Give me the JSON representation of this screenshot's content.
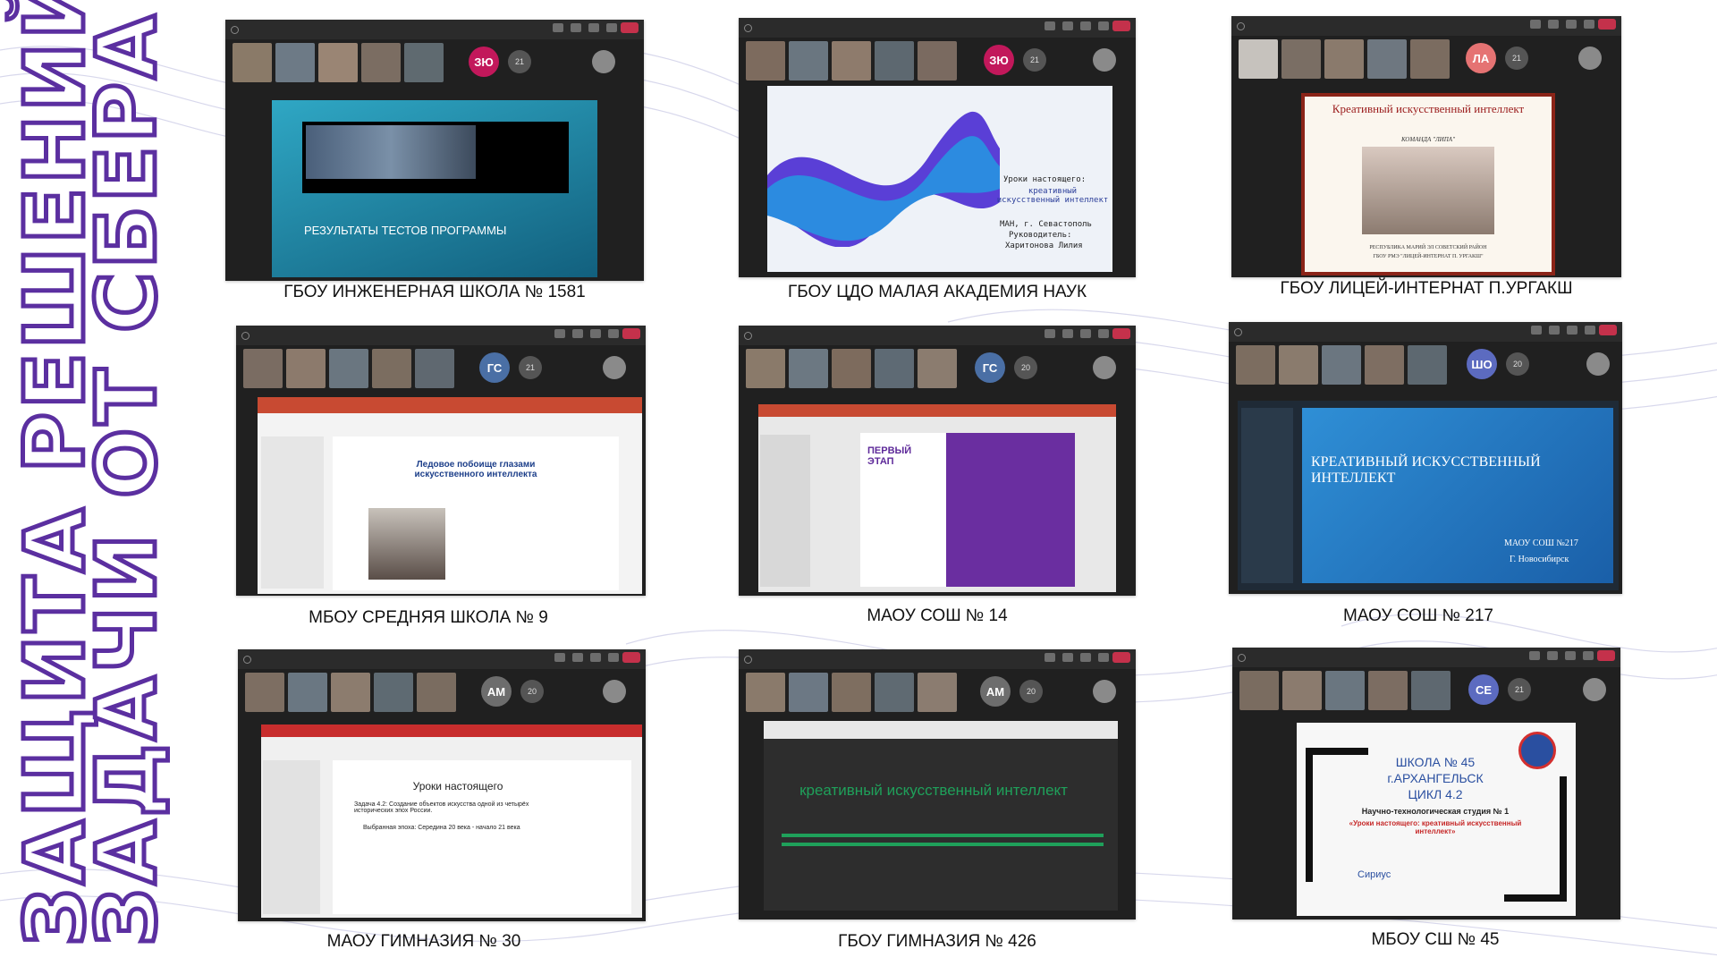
{
  "title": {
    "line1": "ЗАЩИТА РЕШЕНИЙ",
    "line2": "ЗАДАЧИ ОТ СБЕРА"
  },
  "colors": {
    "title_stroke": "#5b2fa0",
    "background_lines": "#d8d8ec"
  },
  "tiles": [
    {
      "caption": "ГБОУ ИНЖЕНЕРНАЯ ШКОЛА № 1581",
      "avatar": {
        "initials": "ЗЮ",
        "color": "#c2185b"
      },
      "slide": {
        "text": "РЕЗУЛЬТАТЫ ТЕСТОВ ПРОГРАММЫ"
      }
    },
    {
      "caption": "ГБОУ ЦДО МАЛАЯ АКАДЕМИЯ НАУК",
      "avatar": {
        "initials": "ЗЮ",
        "color": "#c2185b"
      },
      "slide": {
        "text1": "Уроки настоящего:",
        "text2": "креативный искусственный интеллект",
        "text3": "МАН, г. Севастополь",
        "text4": "Руководитель:",
        "text5": "Харитонова Лилия"
      }
    },
    {
      "caption": "ГБОУ ЛИЦЕЙ-ИНТЕРНАТ П.УРГАКШ",
      "avatar": {
        "initials": "ЛА",
        "color": "#e57373"
      },
      "slide": {
        "title": "Креативный искусственный интеллект",
        "subtitle": "КОМАНДА \"ЛИПА\"",
        "footer1": "РЕСПУБЛИКА МАРИЙ ЭЛ СОВЕТСКИЙ РАЙОН",
        "footer2": "ГБОУ РМЭ \"ЛИЦЕЙ-ИНТЕРНАТ П. УРГАКШ\""
      }
    },
    {
      "caption": "МБОУ СРЕДНЯЯ ШКОЛА № 9",
      "avatar": {
        "initials": "ГС",
        "color": "#4a6fa5"
      },
      "slide": {
        "title": "Ледовое побоище глазами искусственного интеллекта"
      }
    },
    {
      "caption": "МАОУ СОШ № 14",
      "avatar": {
        "initials": "ГС",
        "color": "#4a6fa5"
      },
      "slide": {
        "title": "ПЕРВЫЙ ЭТАП"
      }
    },
    {
      "caption": "МАОУ СОШ № 217",
      "avatar": {
        "initials": "ШО",
        "color": "#5c6bc0"
      },
      "slide": {
        "title": "КРЕАТИВНЫЙ ИСКУССТВЕННЫЙ ИНТЕЛЛЕКТ",
        "sub1": "МАОУ СОШ №217",
        "sub2": "Г. Новосибирск"
      }
    },
    {
      "caption": "МАОУ ГИМНАЗИЯ № 30",
      "avatar": {
        "initials": "АМ",
        "color": "#6d6d6d"
      },
      "slide": {
        "title": "Уроки настоящего",
        "bullet": "Задача 4.2: Создание объектов искусства одной из четырёх исторических эпох России.",
        "line": "Выбранная эпоха: Середина 20 века - начало 21 века"
      }
    },
    {
      "caption": "ГБОУ ГИМНАЗИЯ № 426",
      "avatar": {
        "initials": "АМ",
        "color": "#6d6d6d"
      },
      "slide": {
        "title": "креативный искусственный интеллект"
      }
    },
    {
      "caption": "МБОУ СШ № 45",
      "avatar": {
        "initials": "СЕ",
        "color": "#5c6bc0"
      },
      "slide": {
        "line1": "ШКОЛА № 45",
        "line2": "г.АРХАНГЕЛЬСК",
        "line3": "ЦИКЛ 4.2",
        "line4": "Научно-технологическая студия № 1",
        "line5": "«Уроки настоящего: креативный искусственный интеллект»",
        "brand": "Сириус"
      }
    }
  ]
}
